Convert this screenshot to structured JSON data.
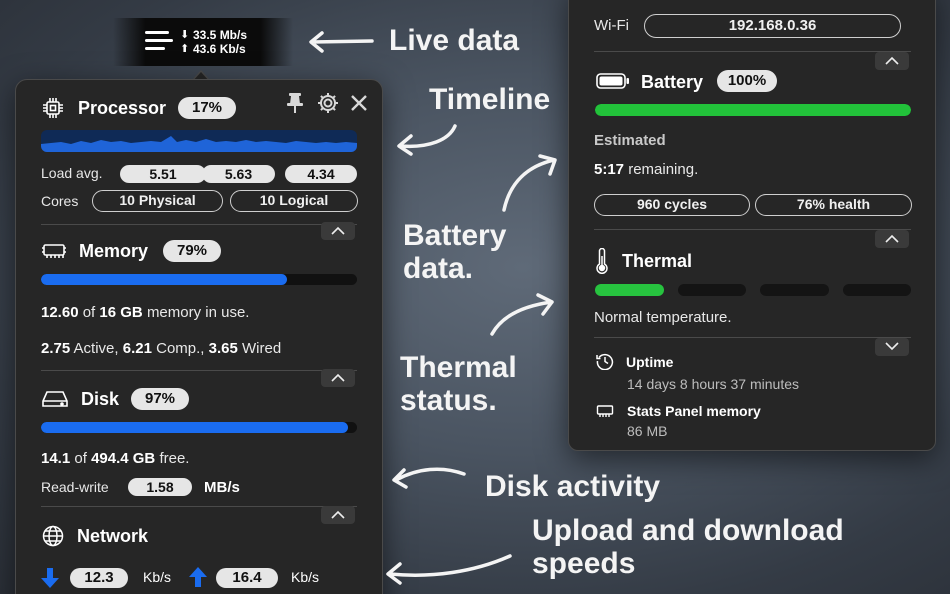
{
  "menubar": {
    "download_speed": "33.5 Mb/s",
    "upload_speed": "43.6 Kb/s"
  },
  "processor": {
    "title": "Processor",
    "percent": "17%",
    "load_label": "Load avg.",
    "load": [
      "5.51",
      "5.63",
      "4.34"
    ],
    "cores_label": "Cores",
    "physical": "10 Physical",
    "logical": "10 Logical"
  },
  "memory": {
    "title": "Memory",
    "percent": "79%",
    "usage": 0.78,
    "used": "12.60",
    "of": "of",
    "total": "16 GB",
    "in_use": "memory in use.",
    "active": "2.75",
    "active_label": "Active,",
    "comp": "6.21",
    "comp_label": "Comp.,",
    "wired": "3.65",
    "wired_label": "Wired"
  },
  "disk": {
    "title": "Disk",
    "percent": "97%",
    "usage": 0.97,
    "free": "14.1",
    "of": "of",
    "total": "494.4 GB",
    "free_label": "free.",
    "rw_label": "Read-write",
    "rw_value": "1.58",
    "rw_unit": "MB/s"
  },
  "network": {
    "title": "Network",
    "download": "12.3",
    "download_unit": "Kb/s",
    "upload": "16.4",
    "upload_unit": "Kb/s"
  },
  "wifi": {
    "label": "Wi-Fi",
    "ip": "192.168.0.36"
  },
  "battery": {
    "title": "Battery",
    "percent": "100%",
    "level": 1.0,
    "estimated_label": "Estimated",
    "remaining_time": "5:17",
    "remaining_label": "remaining.",
    "cycles": "960 cycles",
    "health": "76% health"
  },
  "thermal": {
    "title": "Thermal",
    "level": 1,
    "levels_total": 4,
    "status": "Normal temperature."
  },
  "uptime": {
    "title": "Uptime",
    "value": "14 days 8 hours 37 minutes"
  },
  "stats_memory": {
    "title": "Stats Panel memory",
    "value": "86 MB"
  },
  "annotations": {
    "live_data": "Live data",
    "timeline": "Timeline",
    "battery_1": "Battery",
    "battery_2": "data.",
    "thermal_1": "Thermal",
    "thermal_2": "status.",
    "disk_activity": "Disk activity",
    "speeds_1": "Upload and download",
    "speeds_2": "speeds"
  },
  "colors": {
    "accent_blue": "#1a6cf0",
    "battery_green": "#22c23a",
    "thermal_green": "#27c33f",
    "panel_bg": "#262626"
  }
}
